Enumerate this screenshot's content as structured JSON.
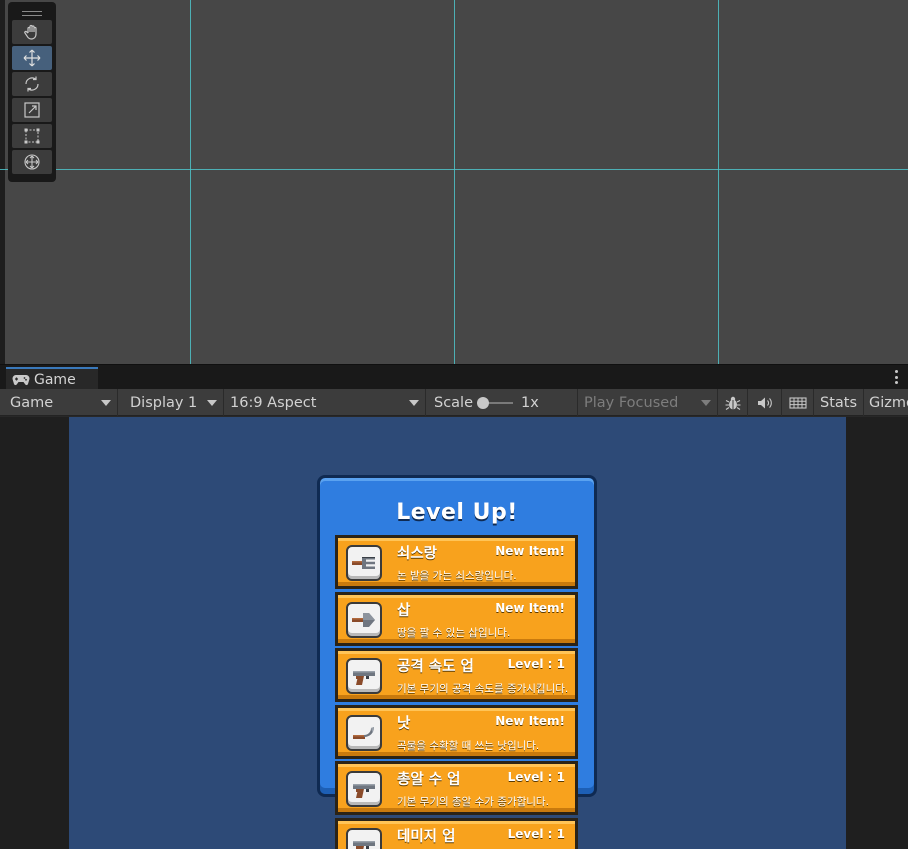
{
  "scene": {
    "tools": [
      {
        "name": "hand-tool",
        "icon": "hand-icon",
        "active": false
      },
      {
        "name": "move-tool",
        "icon": "move-icon",
        "active": true
      },
      {
        "name": "rotate-tool",
        "icon": "rotate-icon",
        "active": false
      },
      {
        "name": "scale-tool",
        "icon": "scale-icon",
        "active": false
      },
      {
        "name": "rect-tool",
        "icon": "rect-transform-icon",
        "active": false
      },
      {
        "name": "transform-tool",
        "icon": "transform-icon",
        "active": false
      }
    ]
  },
  "game_panel": {
    "tab": {
      "icon": "gamepad-icon",
      "label": "Game"
    },
    "controls": {
      "mode": "Game",
      "display": "Display 1",
      "aspect": "16:9 Aspect",
      "scale_label": "Scale",
      "scale_value": "1x",
      "play_mode": "Play Focused",
      "stats": "Stats",
      "gizmos": "Gizmos"
    }
  },
  "game": {
    "title": "Level Up!",
    "items": [
      {
        "name": "쇠스랑",
        "tag": "New Item!",
        "desc": "논 밭을 가는 쇠스랑입니다.",
        "icon": "pitchfork-icon"
      },
      {
        "name": "삽",
        "tag": "New Item!",
        "desc": "땅을 팔 수 있는 삽입니다.",
        "icon": "shovel-icon"
      },
      {
        "name": "공격 속도 업",
        "tag": "Level : 1",
        "desc": "기본 무기의 공격 속도를 증가시킵니다.",
        "icon": "gun-icon"
      },
      {
        "name": "낫",
        "tag": "New Item!",
        "desc": "곡물을 수확할 때 쓰는 낫입니다.",
        "icon": "sickle-icon"
      },
      {
        "name": "총알 수 업",
        "tag": "Level : 1",
        "desc": "기본 무기의 총알 수가 증가합니다.",
        "icon": "gun-icon"
      },
      {
        "name": "데미지 업",
        "tag": "Level : 1",
        "desc": "",
        "icon": "gun-icon"
      }
    ]
  },
  "colors": {
    "panel_blue": "#2f7de0",
    "item_orange": "#f8a21d",
    "game_bg": "#2d4a77",
    "guide_cyan": "#4fc3c9"
  }
}
